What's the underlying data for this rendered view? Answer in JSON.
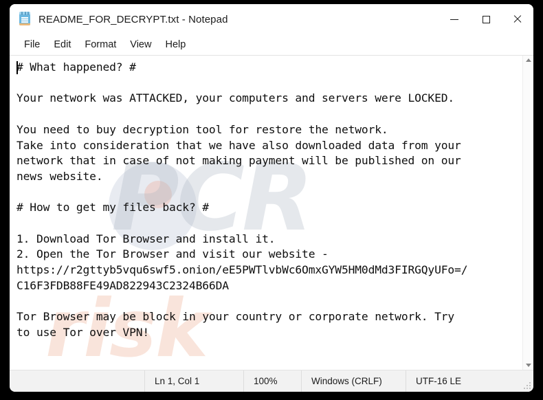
{
  "window": {
    "title": "README_FOR_DECRYPT.txt - Notepad",
    "icon": "notepad-icon",
    "controls": {
      "minimize": "minimize-icon",
      "maximize": "maximize-icon",
      "close": "close-icon"
    }
  },
  "menubar": {
    "items": [
      {
        "label": "File"
      },
      {
        "label": "Edit"
      },
      {
        "label": "Format"
      },
      {
        "label": "View"
      },
      {
        "label": "Help"
      }
    ]
  },
  "editor": {
    "content": "# What happened? #\n\nYour network was ATTACKED, your computers and servers were LOCKED.\n\nYou need to buy decryption tool for restore the network.\nTake into consideration that we have also downloaded data from your\nnetwork that in case of not making payment will be published on our\nnews website.\n\n# How to get my files back? #\n\n1. Download Tor Browser and install it.\n2. Open the Tor Browser and visit our website -\nhttps://r2gttyb5vqu6swf5.onion/eE5PWTlvbWc6OmxGYW5HM0dMd3FIRGQyUFo=/\nC16F3FDB88FE49AD822943C2324B66DA\n\nTor Browser may be block in your country or corporate network. Try\nto use Tor over VPN!",
    "watermark": {
      "line1": "PCR",
      "line2": "risk"
    }
  },
  "scrollbar": {
    "up_arrow": "scroll-up-icon",
    "down_arrow": "scroll-down-icon"
  },
  "statusbar": {
    "position": "Ln 1, Col 1",
    "zoom": "100%",
    "line_ending": "Windows (CRLF)",
    "encoding": "UTF-16 LE"
  },
  "colors": {
    "desktop": "#000000",
    "window": "#ffffff",
    "statusbar": "#f2f2f2",
    "text": "#0f0f0f",
    "icon_blue": "#6cb8e0",
    "icon_tan": "#e8b87a"
  }
}
